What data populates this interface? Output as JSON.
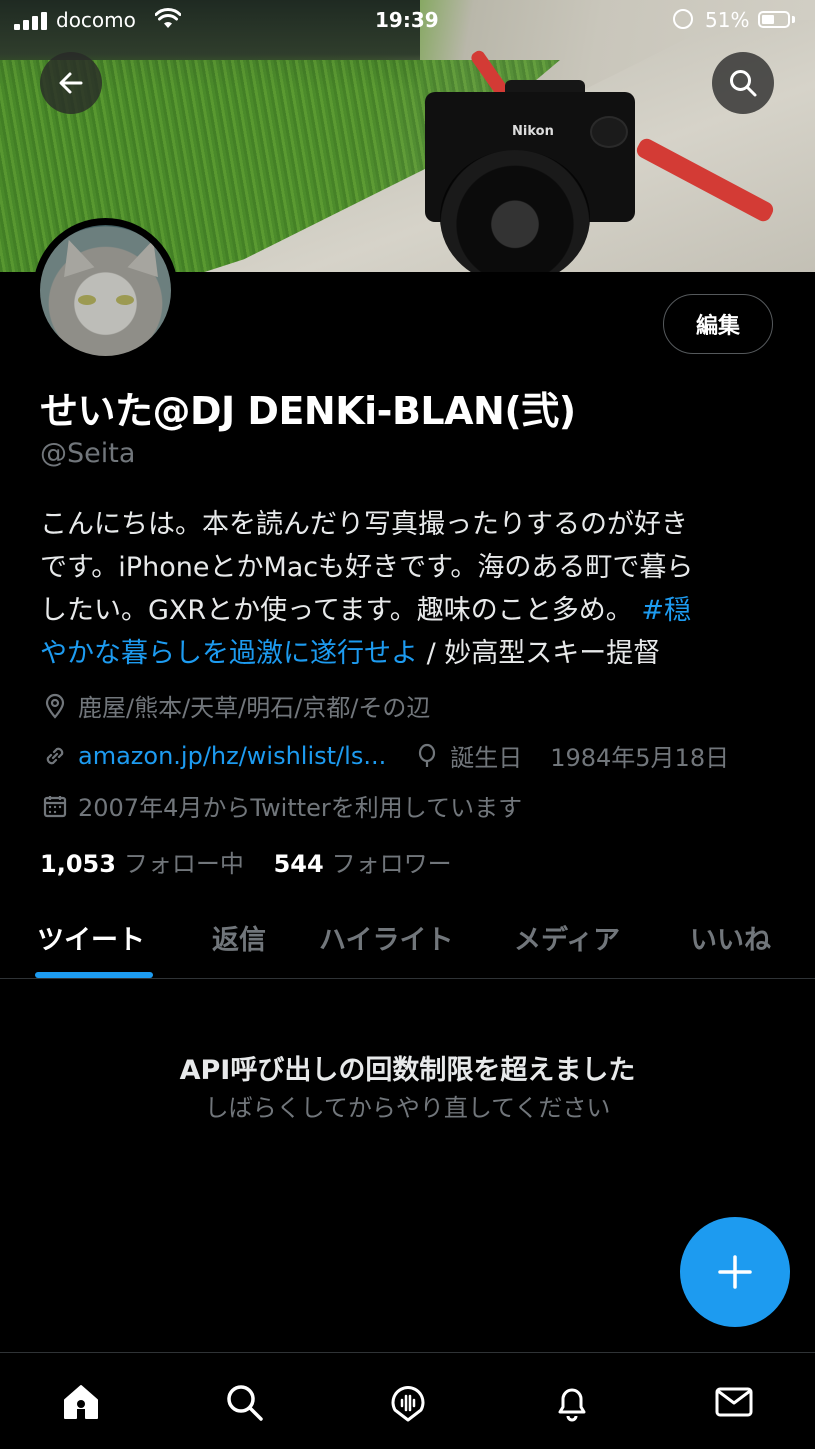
{
  "status_bar": {
    "carrier": "docomo",
    "time": "19:39",
    "battery_percent": "51%"
  },
  "profile": {
    "display_name": "せいた@DJ DENKi-BLAN(弐)",
    "handle": "@Seita",
    "edit_label": "編集",
    "bio_lines": [
      "こんにちは。本を読んだり写真撮ったりするのが好き",
      "です。iPhoneとかMacも好きです。海のある町で暮ら",
      "したい。GXRとか使ってます。趣味のこと多め。"
    ],
    "bio_hashtag_part1": "#穏",
    "bio_hashtag_part2": "やかな暮らしを過激に遂行せよ",
    "bio_tail": " / 妙高型スキー提督",
    "location": "鹿屋/熊本/天草/明石/京都/その辺",
    "website": "amazon.jp/hz/wishlist/ls...",
    "birthday_label": "誕生日",
    "birthday_value": "1984年5月18日",
    "joined": "2007年4月からTwitterを利用しています",
    "following_count": "1,053",
    "following_label": "フォロー中",
    "followers_count": "544",
    "followers_label": "フォロワー"
  },
  "tabs": [
    {
      "label": "ツイート",
      "active": true
    },
    {
      "label": "返信",
      "active": false
    },
    {
      "label": "ハイライト",
      "active": false
    },
    {
      "label": "メディア",
      "active": false
    },
    {
      "label": "いいね",
      "active": false
    }
  ],
  "error": {
    "title": "API呼び出しの回数制限を超えました",
    "subtitle": "しばらくしてからやり直してください"
  },
  "banner": {
    "camera_brand": "Nikon"
  },
  "bottom_nav": [
    "home-icon",
    "search-icon",
    "spaces-icon",
    "notifications-icon",
    "messages-icon"
  ],
  "colors": {
    "accent": "#1d9bf0",
    "background": "#000000",
    "secondary_text": "#71767b",
    "primary_text": "#e7e9ea"
  }
}
